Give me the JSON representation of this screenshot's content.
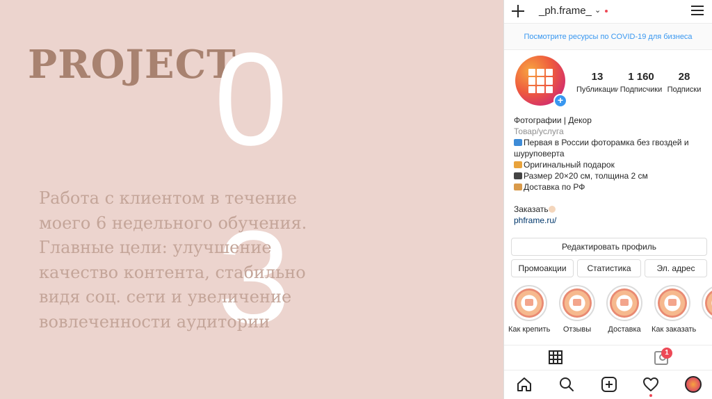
{
  "slide": {
    "title": "PROJECT",
    "number_top": "0",
    "number_bottom": "3",
    "description_lines": [
      "Работа с клиентом в течение",
      "моего 6 недельного обучения.",
      "Главные цели: улучшение",
      "качество контента, стабильно",
      "видя соц. сети и увеличение",
      "вовлеченности аудитории"
    ]
  },
  "instagram": {
    "header": {
      "username": "_ph.frame_",
      "chevron": "⌄",
      "icons": [
        "plus-icon",
        "chevron-down-icon",
        "menu-icon"
      ]
    },
    "covid_banner": "Посмотрите ресурсы по COVID-19 для бизнеса",
    "stats": [
      {
        "value": "13",
        "label": "Публикации"
      },
      {
        "value": "1 160",
        "label": "Подписчики"
      },
      {
        "value": "28",
        "label": "Подписки"
      }
    ],
    "bio": {
      "name": "Фотографии | Декор",
      "category": "Товар/услуга",
      "line1": "Первая в России фоторамка без гвоздей и",
      "line2": "шуруповерта",
      "line3": "Оригинальный подарок",
      "line4": "Размер 20×20 см, толщина 2 см",
      "line5": "Доставка по РФ",
      "line6": "Заказать",
      "link": "phframe.ru/"
    },
    "buttons": {
      "edit_profile": "Редактировать профиль",
      "promotions": "Промоакции",
      "insights": "Статистика",
      "email": "Эл. адрес"
    },
    "highlights": [
      {
        "label": "Как крепить"
      },
      {
        "label": "Отзывы"
      },
      {
        "label": "Доставка"
      },
      {
        "label": "Как заказать"
      }
    ],
    "tagged_badge": "1",
    "colors": {
      "accent": "#3897f0",
      "notification": "#ed4956",
      "slide_background": "#ecd4ce",
      "slide_text": "#a88270"
    }
  }
}
